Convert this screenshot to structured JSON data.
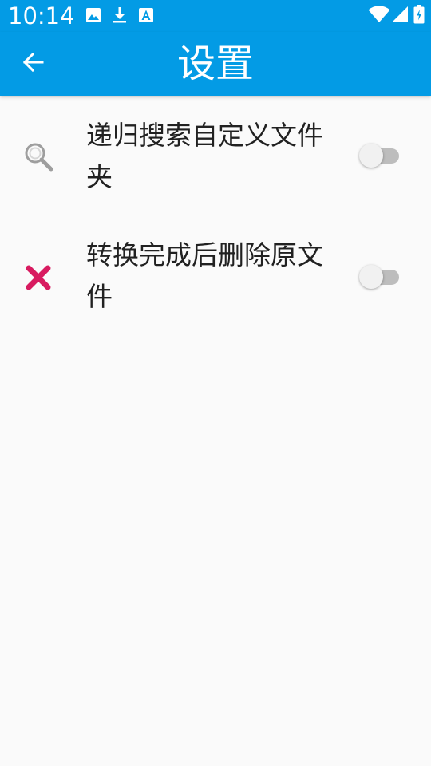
{
  "status_bar": {
    "time": "10:14",
    "icons": [
      "image-icon",
      "download-icon",
      "text-a-icon",
      "wifi-icon",
      "signal-icon",
      "battery-charging-icon"
    ]
  },
  "app_bar": {
    "title": "设置",
    "back_icon": "back-arrow-icon"
  },
  "settings": [
    {
      "icon": "search-icon",
      "label": "递归搜索自定义文件夹",
      "enabled": false
    },
    {
      "icon": "close-icon",
      "label": "转换完成后删除原文件",
      "enabled": false
    }
  ],
  "colors": {
    "primary": "#039be5",
    "background": "#fafafa",
    "text": "#212121",
    "accent_delete": "#d81b60"
  }
}
